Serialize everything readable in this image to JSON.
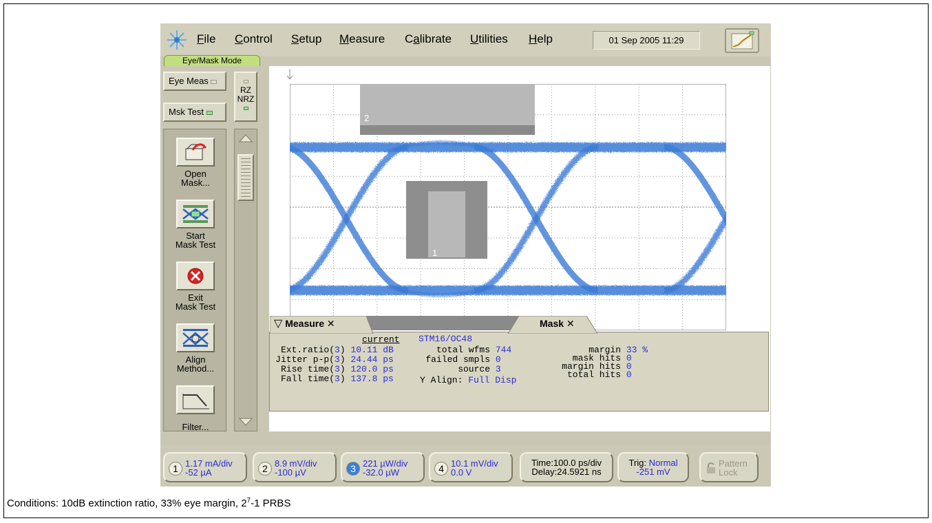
{
  "menubar": {
    "items": [
      {
        "label": "File",
        "underline": "F"
      },
      {
        "label": "Control",
        "underline": "C"
      },
      {
        "label": "Setup",
        "underline": "S"
      },
      {
        "label": "Measure",
        "underline": "M"
      },
      {
        "label": "Calibrate",
        "underline": "a"
      },
      {
        "label": "Utilities",
        "underline": "U"
      },
      {
        "label": "Help",
        "underline": "H"
      }
    ],
    "datetime": "01 Sep 2005  11:29",
    "mode": "Eye/Mask Mode"
  },
  "left_panel": {
    "eye_meas": "Eye Meas",
    "msk_test": "Msk Test",
    "rz": "RZ",
    "nrz": "NRZ",
    "tools": [
      {
        "label1": "Open",
        "label2": "Mask...",
        "icon": "open-mask-icon"
      },
      {
        "label1": "Start",
        "label2": "Mask Test",
        "icon": "start-mask-test-icon"
      },
      {
        "label1": "Exit",
        "label2": "Mask Test",
        "icon": "exit-mask-test-icon"
      },
      {
        "label1": "Align",
        "label2": "Method...",
        "icon": "align-method-icon"
      },
      {
        "label1": "Filter...",
        "label2": "",
        "icon": "filter-icon"
      }
    ]
  },
  "display": {
    "mask_region_1": "1",
    "mask_region_2": "2",
    "trace_color": "#3b7ad6",
    "mask_color": "#8e8e8e"
  },
  "measure_panel": {
    "measure_tab": "Measure",
    "mask_tab": "Mask",
    "current_header": "current",
    "rows": [
      {
        "name": "Ext.ratio(",
        "src": "3",
        "close": ")",
        "value": "10.11 dB"
      },
      {
        "name": "Jitter p-p(",
        "src": "3",
        "close": ")",
        "value": "24.44 ps"
      },
      {
        "name": "Rise time(",
        "src": "3",
        "close": ")",
        "value": "120.0 ps"
      },
      {
        "name": "Fall time(",
        "src": "3",
        "close": ")",
        "value": "137.8 ps"
      }
    ],
    "mask_name": "STM16/OC48",
    "mask_rows": [
      {
        "label": "total wfms",
        "value": "744"
      },
      {
        "label": "failed smpls",
        "value": "0"
      },
      {
        "label": "source",
        "value": "3"
      }
    ],
    "y_align_label": "Y Align:",
    "y_align_value": "Full Disp",
    "margin_rows": [
      {
        "label": "margin",
        "value": "33 %"
      },
      {
        "label": "mask hits",
        "value": "0"
      },
      {
        "label": "margin hits",
        "value": "0"
      },
      {
        "label": "total hits",
        "value": "0"
      }
    ]
  },
  "channels": [
    {
      "num": "1",
      "line1": "1.17 mA/div",
      "line2": "-52 µA",
      "selected": false
    },
    {
      "num": "2",
      "line1": "8.9 mV/div",
      "line2": "-100 µV",
      "selected": false
    },
    {
      "num": "3",
      "line1": "221 µW/div",
      "line2": "-32.0 µW",
      "selected": true
    },
    {
      "num": "4",
      "line1": "10.1 mV/div",
      "line2": "0.0 V",
      "selected": false
    }
  ],
  "timebase": {
    "line1": "Time:100.0 ps/div",
    "line2": "Delay:24.5921 ns"
  },
  "trigger": {
    "line1_label": "Trig:",
    "line1_value": "Normal",
    "line2": "-251 mV"
  },
  "pattern_lock": {
    "line1": "Pattern",
    "line2": "Lock"
  },
  "caption": {
    "text_a": "Conditions: 10dB extinction ratio, 33% eye margin, 2",
    "sup": "7",
    "text_b": "-1 PRBS"
  }
}
